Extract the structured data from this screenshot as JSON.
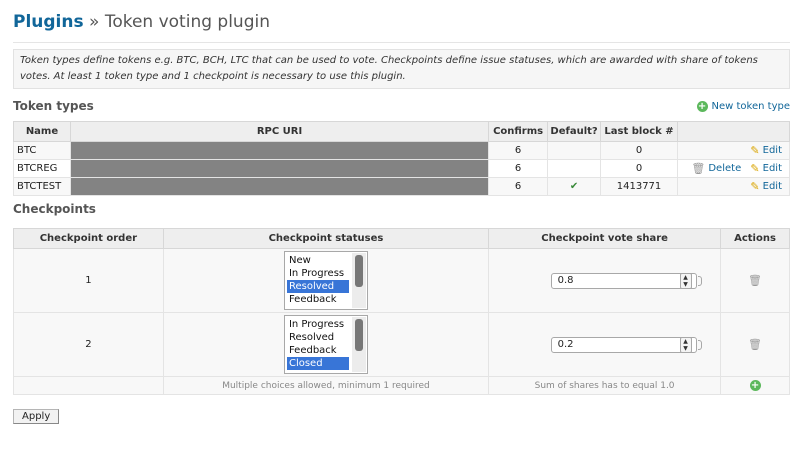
{
  "header": {
    "breadcrumb_root": "Plugins",
    "separator": "»",
    "title": "Token voting plugin"
  },
  "info_text": "Token types define tokens e.g. BTC, BCH, LTC that can be used to vote. Checkpoints define issue statuses, which are awarded with share of tokens votes. At least 1 token type and 1 checkpoint is necessary to use this plugin.",
  "token_types": {
    "heading": "Token types",
    "new_label": "New token type",
    "columns": [
      "Name",
      "RPC URI",
      "Confirms",
      "Default?",
      "Last block #",
      ""
    ],
    "rows": [
      {
        "name": "BTC",
        "confirms": "6",
        "default": "",
        "last_block": "0",
        "delete_label": "",
        "edit_label": "Edit"
      },
      {
        "name": "BTCREG",
        "confirms": "6",
        "default": "",
        "last_block": "0",
        "delete_label": "Delete",
        "edit_label": "Edit"
      },
      {
        "name": "BTCTEST",
        "confirms": "6",
        "default": "✔",
        "last_block": "1413771",
        "delete_label": "",
        "edit_label": "Edit"
      }
    ]
  },
  "checkpoints": {
    "heading": "Checkpoints",
    "columns": [
      "Checkpoint order",
      "Checkpoint statuses",
      "Checkpoint vote share",
      "Actions"
    ],
    "rows": [
      {
        "order": "1",
        "statuses": [
          "New",
          "In Progress",
          "Resolved",
          "Feedback"
        ],
        "selected": "Resolved",
        "share": "0.8"
      },
      {
        "order": "2",
        "statuses": [
          "In Progress",
          "Resolved",
          "Feedback",
          "Closed"
        ],
        "selected": "Closed",
        "share": "0.2"
      }
    ],
    "statuses_hint": "Multiple choices allowed, minimum 1 required",
    "share_hint": "Sum of shares has to equal 1.0"
  },
  "apply_label": "Apply",
  "colors": {
    "link": "#169",
    "selected_option": "#3875d7",
    "add_icon": "#5cb85c",
    "redacted": "#838383"
  },
  "icons": [
    "plus-circle-icon",
    "pencil-icon",
    "trash-icon",
    "checkmark-icon"
  ]
}
